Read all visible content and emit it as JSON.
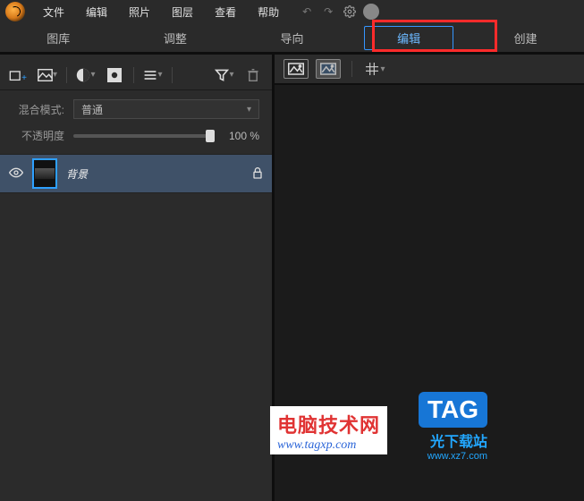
{
  "menu": {
    "items": [
      "文件",
      "编辑",
      "照片",
      "图层",
      "查看",
      "帮助"
    ]
  },
  "tabs": {
    "items": [
      "图库",
      "调整",
      "导向",
      "编辑",
      "创建"
    ],
    "activeIndex": 3
  },
  "panel": {
    "blend_label": "混合模式:",
    "blend_value": "普通",
    "opacity_label": "不透明度",
    "opacity_value": "100 %"
  },
  "layers": [
    {
      "name": "背景"
    }
  ],
  "watermarks": {
    "site1_title": "电脑技术网",
    "site1_url": "www.tagxp.com",
    "tag_label": "TAG",
    "site2_suffix": "光下载站",
    "site2_url": "www.xz7.com"
  }
}
